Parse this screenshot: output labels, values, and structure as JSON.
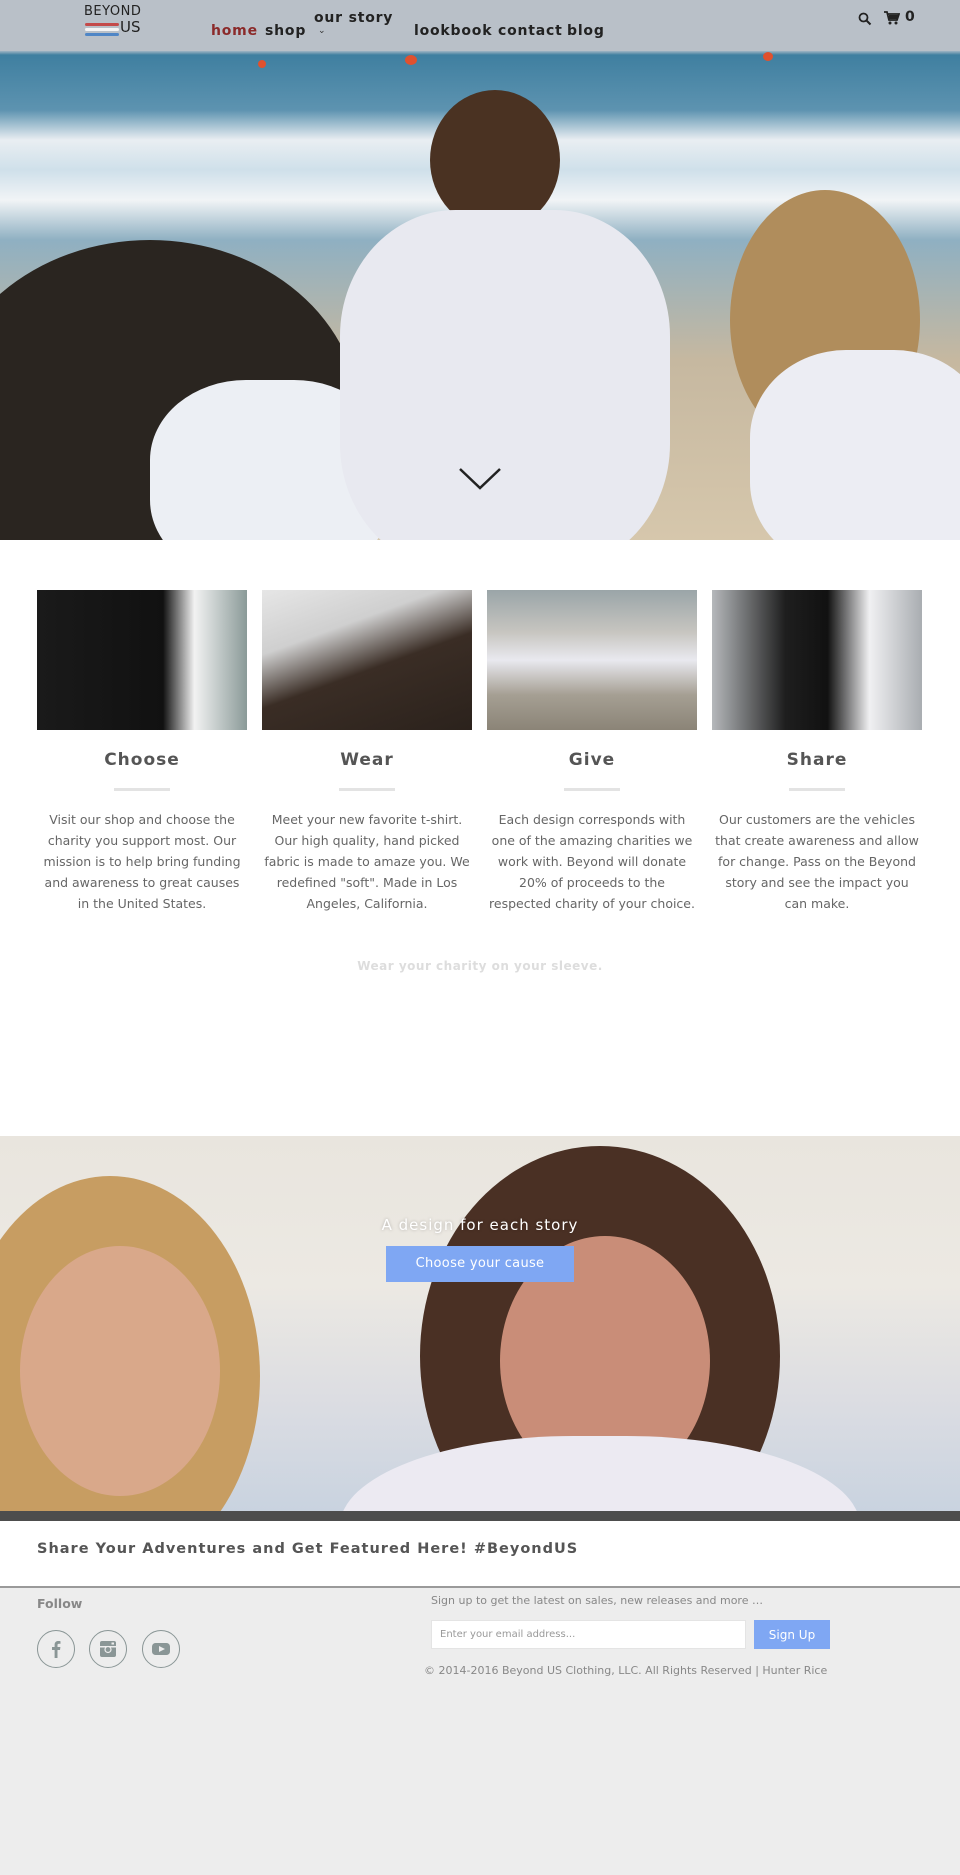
{
  "brand": {
    "logo_line1": "BEYOND",
    "logo_line2": "US"
  },
  "nav": {
    "items": [
      {
        "label": "home",
        "active": true
      },
      {
        "label": "shop"
      },
      {
        "label": "our story",
        "has_dropdown": true
      },
      {
        "label": "lookbook"
      },
      {
        "label": "contact"
      },
      {
        "label": "blog"
      }
    ],
    "dropdown_glyph": "⌄",
    "cart_count": "0"
  },
  "features": [
    {
      "title": "Choose",
      "text": "Visit our shop and choose the charity you support most. Our mission is to help bring funding and awareness to great causes in the United States."
    },
    {
      "title": "Wear",
      "text": "Meet your new favorite t-shirt. Our high quality, hand picked fabric is made to amaze you. We redefined \"soft\". Made in Los Angeles, California."
    },
    {
      "title": "Give",
      "text": "Each design corresponds with one of the amazing charities we work with. Beyond will donate 20% of proceeds to the respected charity of your choice."
    },
    {
      "title": "Share",
      "text": "Our customers are the vehicles that create awareness and allow for change. Pass on the Beyond story and see the impact you can make."
    }
  ],
  "tagline": "Wear your charity on your sleeve.",
  "banner": {
    "title": "A design for each story",
    "button_label": "Choose your cause"
  },
  "instagram": {
    "heading": "Share Your Adventures and Get Featured Here! #BeyondUS"
  },
  "footer": {
    "follow_label": "Follow",
    "social": [
      "facebook",
      "instagram",
      "youtube"
    ],
    "signup_text": "Sign up to get the latest on sales, new releases and more …",
    "email_placeholder": "Enter your email address...",
    "signup_button": "Sign Up",
    "copyright": "© 2014-2016 Beyond US Clothing, LLC. All Rights Reserved | Hunter Rice"
  },
  "colors": {
    "accent": "#7fa7f3",
    "nav_active": "#8b2a2a",
    "dark_bar": "#4d4d4d"
  }
}
